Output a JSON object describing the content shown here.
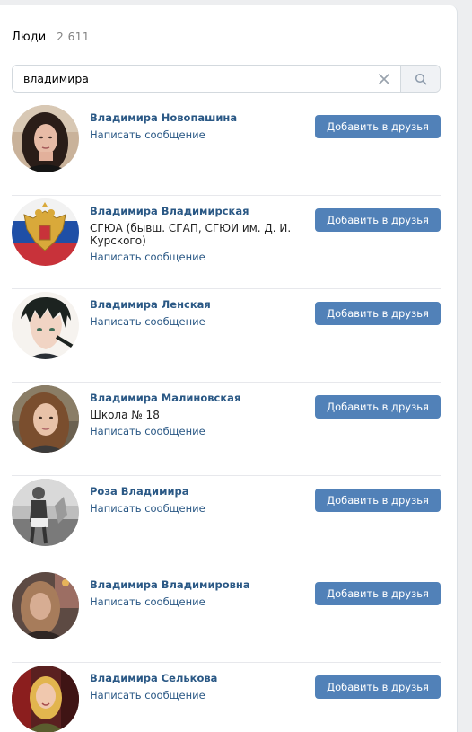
{
  "header": {
    "title": "Люди",
    "count": "2 611"
  },
  "search": {
    "value": "владимира",
    "clear_icon": "close-icon",
    "search_icon": "search-icon"
  },
  "colors": {
    "link": "#2a5885",
    "button": "#5181b8",
    "page_bg": "#edeef0"
  },
  "people": [
    {
      "name": "Владимира Новопашина",
      "sub": "",
      "message": "Написать сообщение",
      "button": "Добавить в друзья",
      "avatar": "woman-dark-hair-photo"
    },
    {
      "name": "Владимира Владимирская",
      "sub": "СГЮА (бывш. СГАП, СГЮИ им. Д. И. Курского)",
      "message": "Написать сообщение",
      "button": "Добавить в друзья",
      "avatar": "russian-coat-of-arms"
    },
    {
      "name": "Владимира Ленская",
      "sub": "",
      "message": "Написать сообщение",
      "button": "Добавить в друзья",
      "avatar": "anime-character-drawing"
    },
    {
      "name": "Владимира Малиновская",
      "sub": "Школа № 18",
      "message": "Написать сообщение",
      "button": "Добавить в друзья",
      "avatar": "girl-long-hair-photo"
    },
    {
      "name": "Роза Владимира",
      "sub": "",
      "message": "Написать сообщение",
      "button": "Добавить в друзья",
      "avatar": "black-and-white-photo"
    },
    {
      "name": "Владимира Владимировна",
      "sub": "",
      "message": "Написать сообщение",
      "button": "Добавить в друзья",
      "avatar": "woman-blurry-photo"
    },
    {
      "name": "Владимира Селькова",
      "sub": "",
      "message": "Написать сообщение",
      "button": "Добавить в друзья",
      "avatar": "blonde-woman-photo"
    }
  ]
}
